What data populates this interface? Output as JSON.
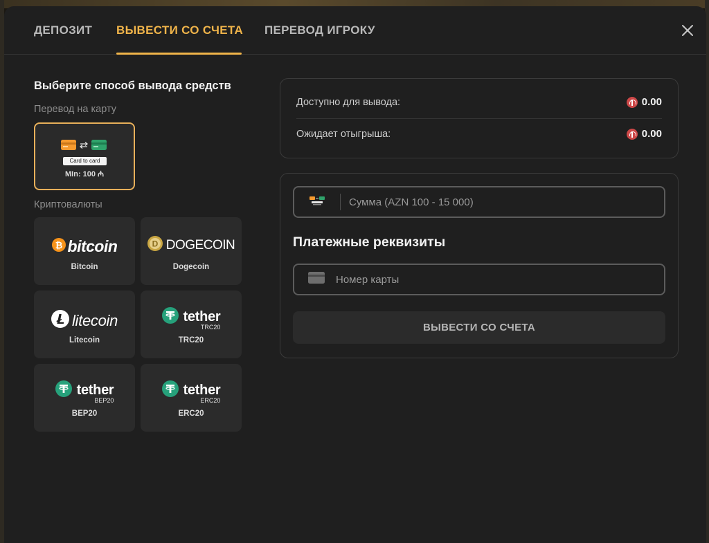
{
  "tabs": [
    {
      "label": "ДЕПОЗИТ"
    },
    {
      "label": "ВЫВЕСТИ СО СЧЕТА"
    },
    {
      "label": "ПЕРЕВОД ИГРОКУ"
    }
  ],
  "active_tab": "ВЫВЕСТИ СО СЧЕТА",
  "methods": {
    "title": "Выберите способ вывода средств",
    "card_group_label": "Перевод на карту",
    "card_option": {
      "badge": "Card to card",
      "min": "MIn: 100 ₼"
    },
    "crypto_group_label": "Криптовалюты",
    "crypto": [
      {
        "logo": "bitcoin",
        "name": "Bitcoin"
      },
      {
        "logo": "DOGECOIN",
        "name": "Dogecoin"
      },
      {
        "logo": "litecoin",
        "name": "Litecoin"
      },
      {
        "logo": "tether",
        "sub": "TRC20",
        "name": "TRC20"
      },
      {
        "logo": "tether",
        "sub": "BEP20",
        "name": "BEP20"
      },
      {
        "logo": "tether",
        "sub": "ERC20",
        "name": "ERC20"
      }
    ]
  },
  "balance": {
    "available_label": "Доступно для вывода:",
    "available_value": "0.00",
    "wager_label": "Ожидает отыгрыша:",
    "wager_value": "0.00"
  },
  "form": {
    "amount_placeholder": "Сумма (AZN 100 - 15 000)",
    "details_heading": "Платежные реквизиты",
    "card_placeholder": "Номер карты",
    "submit_label": "ВЫВЕСТИ СО СЧЕТА"
  },
  "colors": {
    "accent": "#f0b44a",
    "bitcoin": "#f7931a",
    "tether": "#26a17b",
    "currency_coin": "#cc4747"
  },
  "icons": [
    "close-icon",
    "card-transfer-icon",
    "bitcoin-icon",
    "dogecoin-icon",
    "litecoin-icon",
    "tether-icon",
    "currency-coin-icon",
    "card-icon"
  ]
}
